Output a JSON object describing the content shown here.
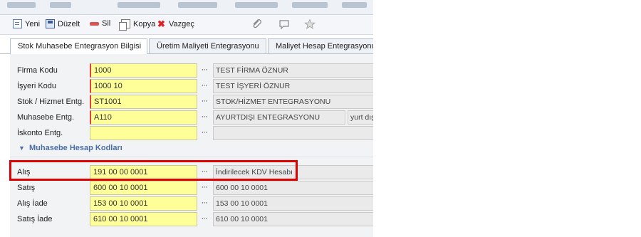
{
  "toolbar": {
    "new_label": "Yeni",
    "edit_label": "Düzelt",
    "delete_label": "Sil",
    "copy_label": "Kopya",
    "cancel_label": "Vazgeç",
    "icons": [
      "paperclip-icon",
      "comment-icon",
      "star-icon"
    ]
  },
  "tabs": [
    {
      "label": "Stok Muhasebe Entegrasyon Bilgisi",
      "active": true
    },
    {
      "label": "Üretim Maliyeti Entegrasyonu",
      "active": false
    },
    {
      "label": "Maliyet Hesap Entegrasyonu",
      "active": false
    }
  ],
  "fields": [
    {
      "label": "Firma Kodu",
      "code": "1000",
      "desc": "TEST FİRMA ÖZNUR"
    },
    {
      "label": "İşyeri Kodu",
      "code": "1000 10",
      "desc": "TEST İŞYERİ ÖZNUR"
    },
    {
      "label": "Stok / Hizmet Entg.",
      "code": "ST1001",
      "desc": "STOK/HİZMET ENTEGRASYONU"
    },
    {
      "label": "Muhasebe Entg.",
      "code": "A110",
      "desc": "AYURTDIŞI ENTEGRASYONU",
      "extra": "yurt dışı"
    },
    {
      "label": "İskonto Entg.",
      "code": "",
      "desc": ""
    }
  ],
  "section": {
    "title": "Muhasebe Hesap Kodları"
  },
  "accounts": [
    {
      "label": "Alış",
      "code": "191 00 00 0001",
      "desc": "İndirilecek KDV Hesabı"
    },
    {
      "label": "Satış",
      "code": "600 00 10 0001",
      "desc": "600 00 10 0001"
    },
    {
      "label": "Alış İade",
      "code": "153 00 10 0001",
      "desc": "153 00 10 0001"
    },
    {
      "label": "Satış İade",
      "code": "610 00 10 0001",
      "desc": "610 00 10 0001"
    }
  ],
  "lookup_label": "···",
  "colors": {
    "highlight": "#e10000",
    "required_field": "#ffff99",
    "section_title": "#4a6ea9"
  }
}
